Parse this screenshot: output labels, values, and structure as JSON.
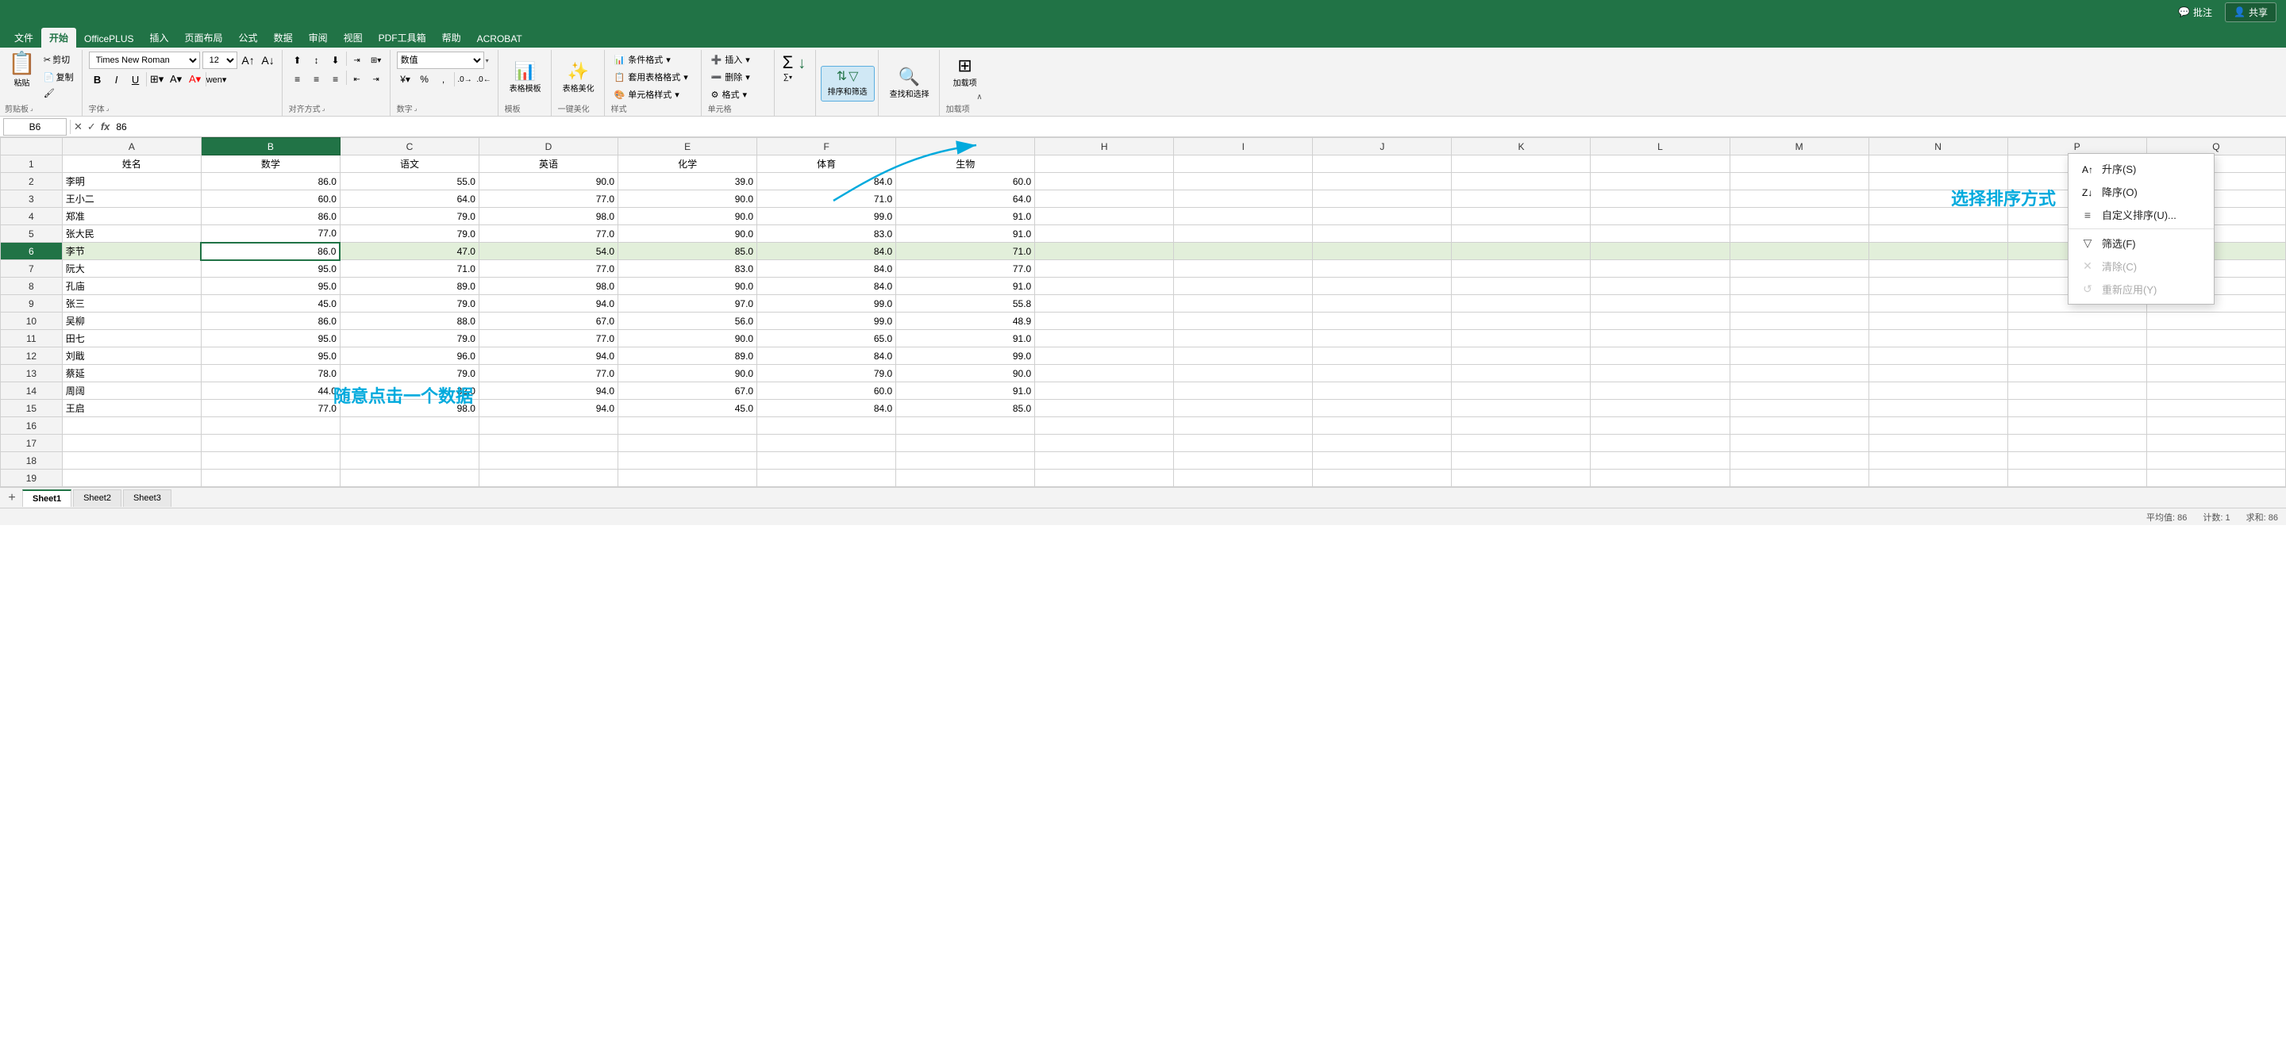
{
  "titlebar": {
    "share_label": "共享",
    "comment_label": "批注"
  },
  "ribbon": {
    "tabs": [
      "文件",
      "开始",
      "OfficePLUS",
      "插入",
      "页面布局",
      "公式",
      "数据",
      "审阅",
      "视图",
      "PDF工具箱",
      "帮助",
      "ACROBAT"
    ],
    "active_tab": "开始",
    "font_name": "Times New Roman",
    "font_size": "12",
    "groups": {
      "clipboard": "剪贴板",
      "font": "字体",
      "alignment": "对齐方式",
      "number": "数字",
      "template": "模板",
      "beautify": "一键美化",
      "style": "样式",
      "cell": "单元格",
      "sort_filter": "排序和筛选",
      "find": "查找和选择",
      "addins": "加载项"
    },
    "number_format": "数值",
    "sort_filter_label": "排序和筛选",
    "find_label": "查找和选择",
    "addins_label": "加载项",
    "insert_label": "插入",
    "delete_label": "删除",
    "format_label": "格式",
    "conditional_format_label": "条件格式",
    "table_format_label": "套用表格格式",
    "cell_style_label": "单元格样式",
    "table_template_label": "表格模板",
    "beautify_label": "表格美化"
  },
  "formula_bar": {
    "cell_ref": "B6",
    "formula": "86"
  },
  "columns": {
    "row_header": "",
    "A": "A",
    "B": "B",
    "C": "C",
    "D": "D",
    "E": "E",
    "F": "F",
    "G": "G",
    "H": "H",
    "I": "I",
    "J": "J",
    "K": "K",
    "L": "L",
    "M": "M",
    "N": "N",
    "P": "P",
    "Q": "Q"
  },
  "headers": [
    "姓名",
    "数学",
    "语文",
    "英语",
    "化学",
    "体育",
    "生物"
  ],
  "rows": [
    {
      "id": 2,
      "name": "李明",
      "math": "86.0",
      "chinese": "55.0",
      "english": "90.0",
      "chemistry": "39.0",
      "pe": "84.0",
      "biology": "60.0"
    },
    {
      "id": 3,
      "name": "王小二",
      "math": "60.0",
      "chinese": "64.0",
      "english": "77.0",
      "chemistry": "90.0",
      "pe": "71.0",
      "biology": "64.0"
    },
    {
      "id": 4,
      "name": "郑准",
      "math": "86.0",
      "chinese": "79.0",
      "english": "98.0",
      "chemistry": "90.0",
      "pe": "99.0",
      "biology": "91.0"
    },
    {
      "id": 5,
      "name": "张大民",
      "math": "77.0",
      "chinese": "79.0",
      "english": "77.0",
      "chemistry": "90.0",
      "pe": "83.0",
      "biology": "91.0"
    },
    {
      "id": 6,
      "name": "李节",
      "math": "86.0",
      "chinese": "47.0",
      "english": "54.0",
      "chemistry": "85.0",
      "pe": "84.0",
      "biology": "71.0"
    },
    {
      "id": 7,
      "name": "阮大",
      "math": "95.0",
      "chinese": "71.0",
      "english": "77.0",
      "chemistry": "83.0",
      "pe": "84.0",
      "biology": "77.0"
    },
    {
      "id": 8,
      "name": "孔庙",
      "math": "95.0",
      "chinese": "89.0",
      "english": "98.0",
      "chemistry": "90.0",
      "pe": "84.0",
      "biology": "91.0"
    },
    {
      "id": 9,
      "name": "张三",
      "math": "45.0",
      "chinese": "79.0",
      "english": "94.0",
      "chemistry": "97.0",
      "pe": "99.0",
      "biology": "55.8"
    },
    {
      "id": 10,
      "name": "吴柳",
      "math": "86.0",
      "chinese": "88.0",
      "english": "67.0",
      "chemistry": "56.0",
      "pe": "99.0",
      "biology": "48.9"
    },
    {
      "id": 11,
      "name": "田七",
      "math": "95.0",
      "chinese": "79.0",
      "english": "77.0",
      "chemistry": "90.0",
      "pe": "65.0",
      "biology": "91.0"
    },
    {
      "id": 12,
      "name": "刘戢",
      "math": "95.0",
      "chinese": "96.0",
      "english": "94.0",
      "chemistry": "89.0",
      "pe": "84.0",
      "biology": "99.0"
    },
    {
      "id": 13,
      "name": "蔡延",
      "math": "78.0",
      "chinese": "79.0",
      "english": "77.0",
      "chemistry": "90.0",
      "pe": "79.0",
      "biology": "90.0"
    },
    {
      "id": 14,
      "name": "周阔",
      "math": "44.0",
      "chinese": "32.0",
      "english": "94.0",
      "chemistry": "67.0",
      "pe": "60.0",
      "biology": "91.0"
    },
    {
      "id": 15,
      "name": "王启",
      "math": "77.0",
      "chinese": "98.0",
      "english": "94.0",
      "chemistry": "45.0",
      "pe": "84.0",
      "biology": "85.0"
    }
  ],
  "sort_dropdown": {
    "items": [
      {
        "id": "sort-asc",
        "icon": "↑",
        "label": "升序(S)"
      },
      {
        "id": "sort-desc",
        "icon": "↓",
        "label": "降序(O)"
      },
      {
        "id": "sort-custom",
        "icon": "≡",
        "label": "自定义排序(U)..."
      },
      {
        "id": "filter",
        "icon": "▽",
        "label": "筛选(F)"
      },
      {
        "id": "clear",
        "icon": "✕",
        "label": "清除(C)"
      },
      {
        "id": "reapply",
        "icon": "↺",
        "label": "重新应用(Y)"
      }
    ]
  },
  "annotations": {
    "text1": "选择排序方式",
    "text2": "随意点击一个数据"
  },
  "active_cell": "B6",
  "sheet_tabs": [
    "Sheet1",
    "Sheet2",
    "Sheet3"
  ],
  "active_sheet": "Sheet1",
  "status_bar": {
    "items": [
      "平均值: 86",
      "计数: 1",
      "求和: 86"
    ]
  }
}
